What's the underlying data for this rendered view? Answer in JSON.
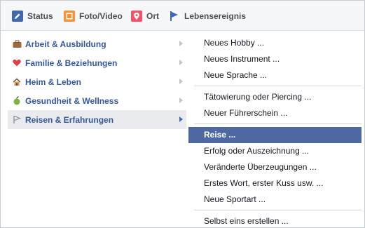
{
  "tabs": [
    {
      "label": "Status",
      "icon": "pencil-icon",
      "color": "#4267b2"
    },
    {
      "label": "Foto/Video",
      "icon": "photo-icon",
      "color": "#f7923b"
    },
    {
      "label": "Ort",
      "icon": "location-pin-icon",
      "color": "#f35369"
    },
    {
      "label": "Lebensereignis",
      "icon": "flag-icon",
      "color": "#4267b2"
    }
  ],
  "active_tab": "Lebensereignis",
  "categories": [
    {
      "label": "Arbeit & Ausbildung",
      "icon": "briefcase-icon"
    },
    {
      "label": "Familie & Beziehungen",
      "icon": "heart-icon"
    },
    {
      "label": "Heim & Leben",
      "icon": "house-icon"
    },
    {
      "label": "Gesundheit & Wellness",
      "icon": "apple-icon"
    },
    {
      "label": "Reisen & Erfahrungen",
      "icon": "flag-icon",
      "selected": true
    }
  ],
  "submenu": {
    "group1": [
      "Neues Hobby ...",
      "Neues Instrument ...",
      "Neue Sprache ..."
    ],
    "group2": [
      "Tätowierung oder Piercing ...",
      "Neuer Führerschein ..."
    ],
    "group3": [
      "Reise ...",
      "Erfolg oder Auszeichnung ...",
      "Veränderte Überzeugungen ...",
      "Erstes Wort, erster Kuss usw. ...",
      "Neue Sportart ..."
    ],
    "group4": [
      "Selbst eins erstellen ..."
    ],
    "selected": "Reise ..."
  },
  "colors": {
    "accent": "#4e69a2",
    "link": "#365899"
  }
}
